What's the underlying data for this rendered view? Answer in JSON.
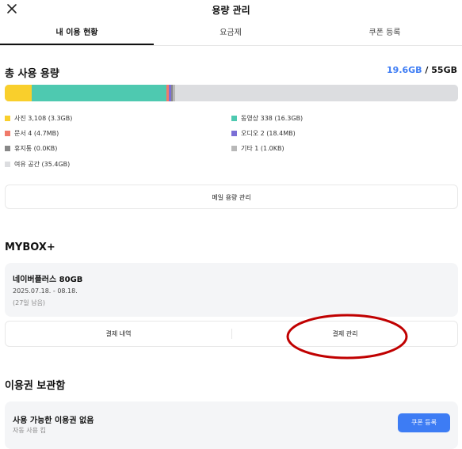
{
  "header": {
    "title": "용량 관리"
  },
  "tabs": [
    {
      "label": "내 이용 현황",
      "active": true
    },
    {
      "label": "요금제",
      "active": false
    },
    {
      "label": "쿠폰 등록",
      "active": false
    }
  ],
  "usage": {
    "section_title": "총 사용 용량",
    "used": "19.6GB",
    "separator": " / ",
    "total": "55GB",
    "segments": [
      {
        "name": "photos",
        "gb": 3.3,
        "color": "#f9cf2c"
      },
      {
        "name": "videos",
        "gb": 16.3,
        "color": "#4ec9b0"
      },
      {
        "name": "documents",
        "gb": 0.0047,
        "color": "#f07a6a"
      },
      {
        "name": "audio",
        "gb": 0.0184,
        "color": "#7b6fd6"
      },
      {
        "name": "trash",
        "gb": 0.0,
        "color": "#888888"
      },
      {
        "name": "other",
        "gb": 0.001,
        "color": "#b8b8b8"
      },
      {
        "name": "free",
        "gb": 35.4,
        "color": "#dcdde0"
      }
    ],
    "legend": [
      {
        "label": "사진 3,108 (3.3GB)",
        "color": "#f9cf2c"
      },
      {
        "label": "동영상 338 (16.3GB)",
        "color": "#4ec9b0"
      },
      {
        "label": "문서 4 (4.7MB)",
        "color": "#f07a6a"
      },
      {
        "label": "오디오 2 (18.4MB)",
        "color": "#7b6fd6"
      },
      {
        "label": "휴지통 (0.0KB)",
        "color": "#888888"
      },
      {
        "label": "기타 1 (1.0KB)",
        "color": "#b8b8b8"
      },
      {
        "label": "여유 공간 (35.4GB)",
        "color": "#dcdde0"
      }
    ],
    "mail_manage_label": "메일 용량 관리"
  },
  "mybox": {
    "section_title": "MYBOX+",
    "plan_name": "네이버플러스 80GB",
    "plan_period": "2025.07.18. - 08.18.",
    "plan_remaining": "(27일 남음)",
    "payment_history_label": "결제 내역",
    "payment_manage_label": "결제 관리"
  },
  "voucher": {
    "section_title": "이용권 보관함",
    "status": "사용 가능한 이용권 없음",
    "sub": "자동 사용 킴",
    "register_label": "쿠폰 등록"
  },
  "colors": {
    "accent": "#3d7cf4",
    "annotation": "#c00000"
  }
}
